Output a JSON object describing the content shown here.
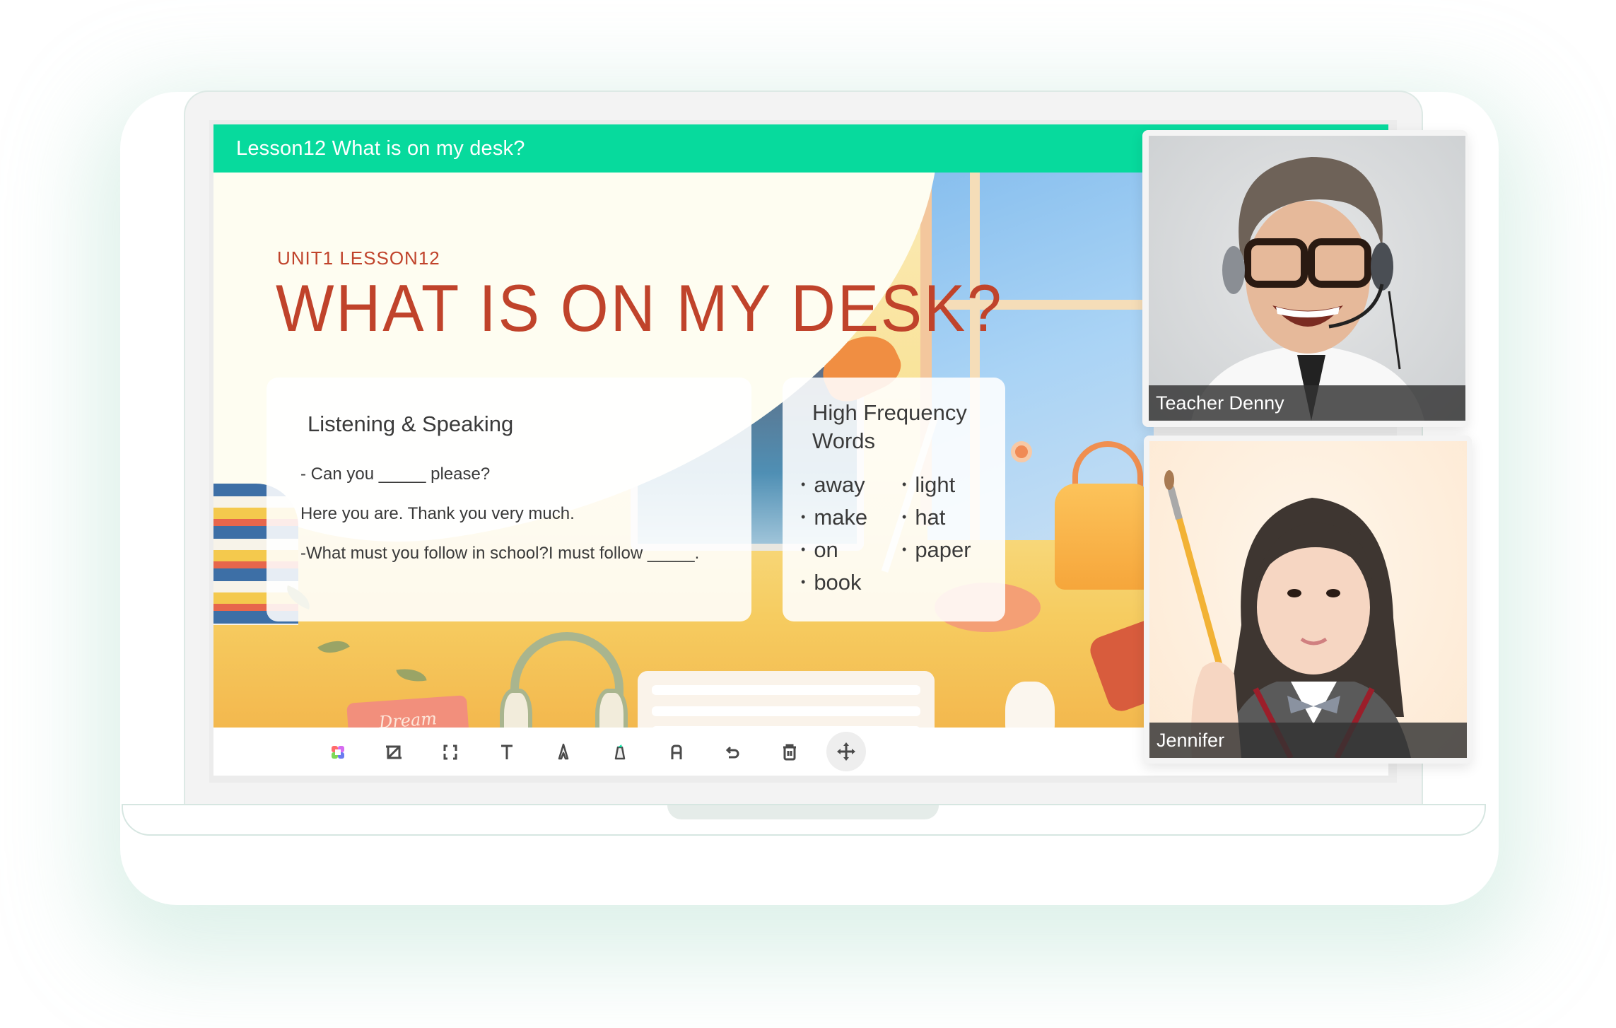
{
  "app": {
    "header_title": "Lesson12  What is on my desk?"
  },
  "slide": {
    "unit_label": "UNIT1  LESSON12",
    "headline": "WHAT IS ON MY DESK?",
    "illustration_text": "Dream",
    "listening_card": {
      "title": "Listening & Speaking",
      "lines": [
        "- Can you _____ please?",
        "Here you are. Thank you very much.",
        "-What must you follow in school?I must follow _____."
      ]
    },
    "words_card": {
      "title": "High Frequency Words",
      "words_left": [
        "away",
        "make",
        "on",
        "book"
      ],
      "words_right": [
        "light",
        "hat",
        "paper"
      ]
    }
  },
  "toolbar": {
    "tools": [
      {
        "id": "color",
        "icon": "color-palette-icon"
      },
      {
        "id": "shape",
        "icon": "crop-shape-icon"
      },
      {
        "id": "select",
        "icon": "selection-icon"
      },
      {
        "id": "text",
        "icon": "text-icon"
      },
      {
        "id": "pen",
        "icon": "pen-icon"
      },
      {
        "id": "highlighter",
        "icon": "highlighter-icon"
      },
      {
        "id": "eraser",
        "icon": "eraser-icon"
      },
      {
        "id": "undo",
        "icon": "undo-icon"
      },
      {
        "id": "delete",
        "icon": "trash-icon"
      },
      {
        "id": "move",
        "icon": "move-icon",
        "active": true
      }
    ]
  },
  "participants": [
    {
      "name": "Teacher Denny",
      "role": "teacher"
    },
    {
      "name": "Jennifer",
      "role": "student"
    }
  ],
  "colors": {
    "accent": "#07da9d",
    "headline": "#c0432b",
    "icon": "#4a4a4a"
  }
}
